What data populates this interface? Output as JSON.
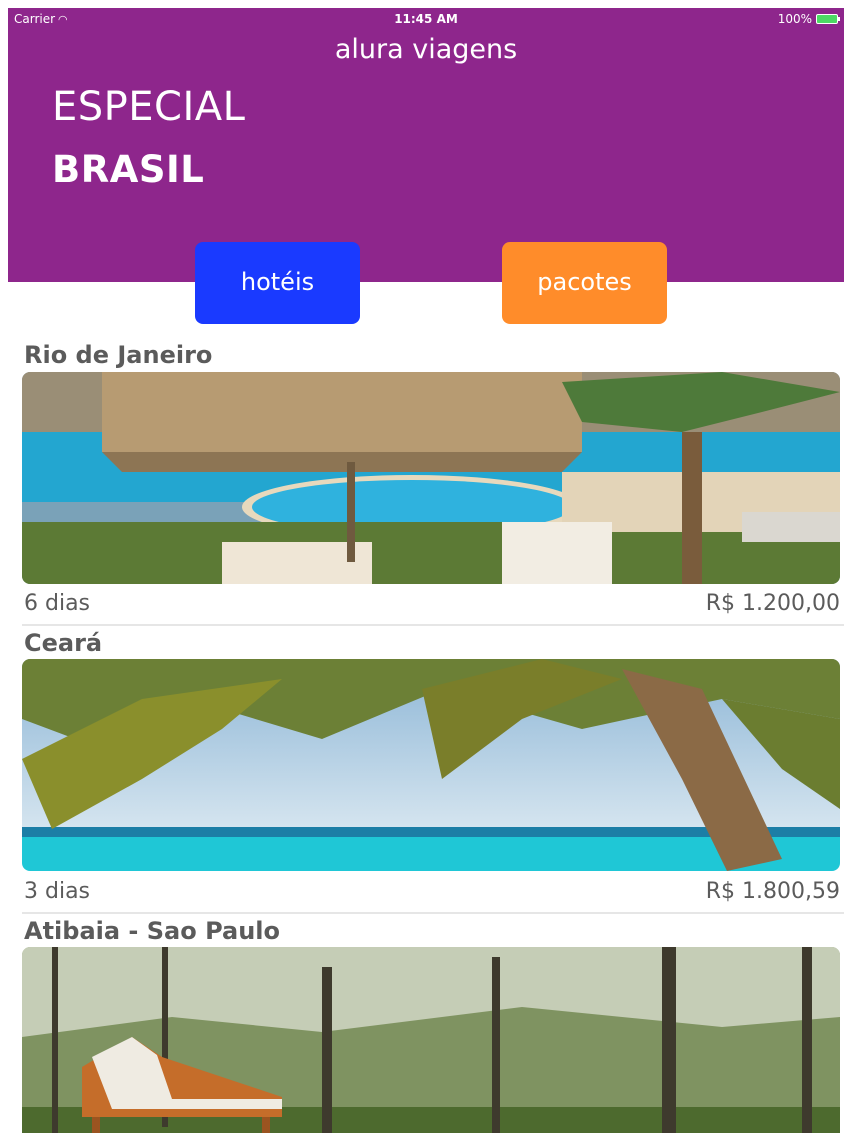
{
  "status_bar": {
    "carrier": "Carrier",
    "time": "11:45 AM",
    "battery": "100%"
  },
  "header": {
    "app_title": "alura viagens",
    "special_label": "ESPECIAL",
    "country_label": "BRASIL",
    "background_color": "#8e268c"
  },
  "buttons": {
    "hotels_label": "hotéis",
    "hotels_color": "#1a3aff",
    "packages_label": "pacotes",
    "packages_color": "#ff8c2a"
  },
  "packages": [
    {
      "title": "Rio de Janeiro",
      "days": "6 dias",
      "price": "R$ 1.200,00",
      "image": "pool-icon"
    },
    {
      "title": "Ceará",
      "days": "3 dias",
      "price": "R$ 1.800,59",
      "image": "beach-palm-icon"
    },
    {
      "title": "Atibaia - Sao Paulo",
      "image": "forest-lounger-icon"
    }
  ]
}
